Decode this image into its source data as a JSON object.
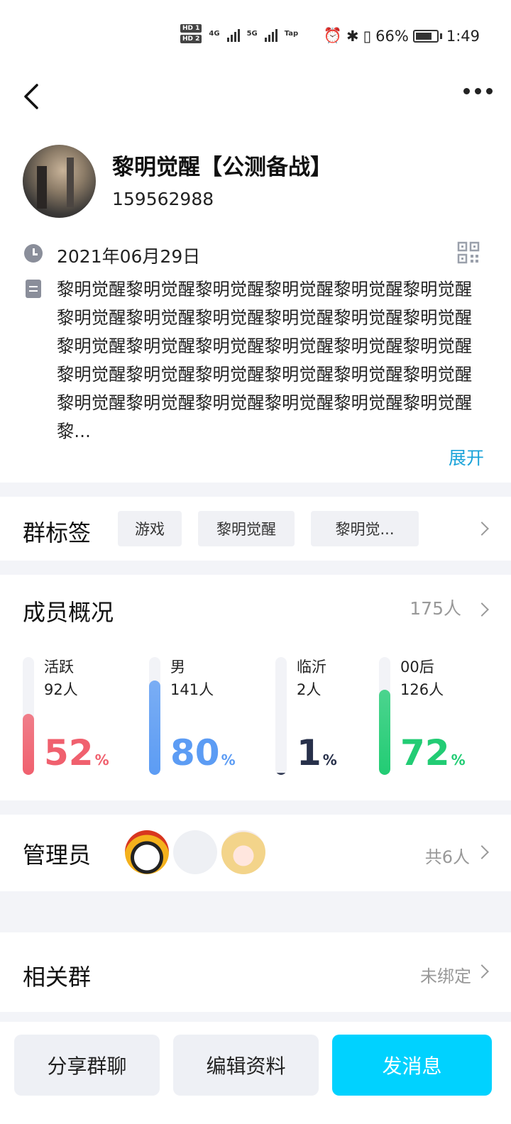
{
  "status_bar": {
    "hd1": "HD 1",
    "hd2": "HD 2",
    "net1": "4G",
    "net2": "5G",
    "tap": "Tap",
    "battery": "66%",
    "time": "1:49"
  },
  "group": {
    "name": "黎明觉醒【公测备战】",
    "id": "159562988",
    "date": "2021年06月29日",
    "description": "黎明觉醒黎明觉醒黎明觉醒黎明觉醒黎明觉醒黎明觉醒黎明觉醒黎明觉醒黎明觉醒黎明觉醒黎明觉醒黎明觉醒黎明觉醒黎明觉醒黎明觉醒黎明觉醒黎明觉醒黎明觉醒黎明觉醒黎明觉醒黎明觉醒黎明觉醒黎明觉醒黎明觉醒黎明觉醒黎明觉醒黎明觉醒黎明觉醒黎明觉醒黎明觉醒黎...",
    "expand_label": "展开"
  },
  "tags": {
    "title": "群标签",
    "items": [
      "游戏",
      "黎明觉醒",
      "黎明觉..."
    ]
  },
  "members": {
    "title": "成员概况",
    "count": "175人",
    "stats": [
      {
        "label": "活跃",
        "count": "92人",
        "percent": "52",
        "unit": "%",
        "fill": 0.52,
        "color": "#f0606e"
      },
      {
        "label": "男",
        "count": "141人",
        "percent": "80",
        "unit": "%",
        "fill": 0.8,
        "color": "#5c9cf4"
      },
      {
        "label": "临沂",
        "count": "2人",
        "percent": "1",
        "unit": "%",
        "fill": 0.01,
        "color": "#27304a"
      },
      {
        "label": "00后",
        "count": "126人",
        "percent": "72",
        "unit": "%",
        "fill": 0.72,
        "color": "#22cc74"
      }
    ]
  },
  "admins": {
    "title": "管理员",
    "total": "共6人"
  },
  "related": {
    "title": "相关群",
    "status": "未绑定"
  },
  "actions": {
    "share": "分享群聊",
    "edit": "编辑资料",
    "message": "发消息"
  }
}
